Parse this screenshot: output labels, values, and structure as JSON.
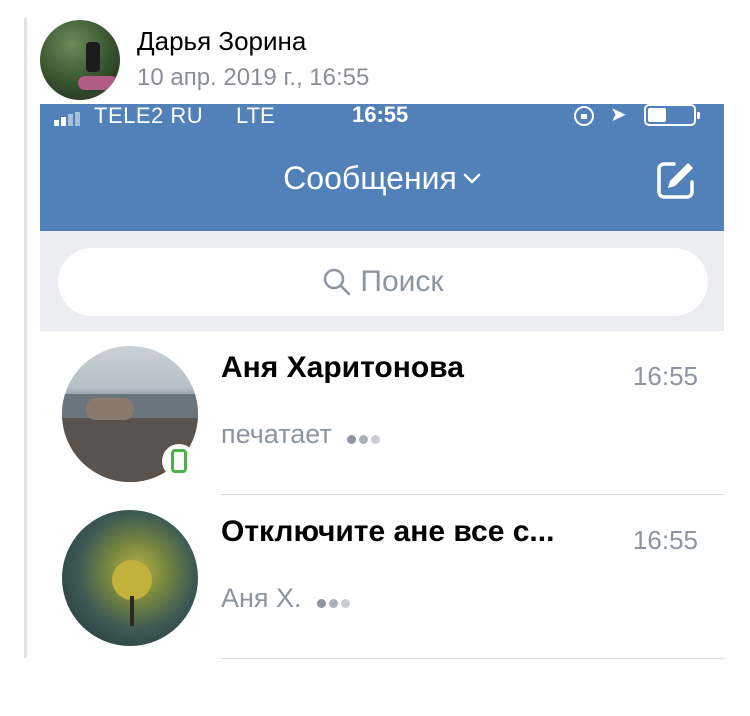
{
  "post": {
    "author": "Дарья Зорина",
    "date": "10 апр. 2019 г., 16:55"
  },
  "status_bar": {
    "carrier": "TELE2 RU",
    "network": "LTE",
    "time": "16:55",
    "icons": [
      "signal-icon",
      "lock-rotation-icon",
      "location-icon",
      "battery-icon"
    ]
  },
  "header": {
    "title": "Сообщения",
    "title_icon": "chevron-down-icon",
    "compose_icon": "compose-icon",
    "color": "#5181b8"
  },
  "search": {
    "placeholder": "Поиск"
  },
  "dialogs": [
    {
      "name": "Аня Харитонова",
      "time": "16:55",
      "preview": "печатает",
      "typing": true,
      "online_mobile": true
    },
    {
      "name": "Отключите ане все с...",
      "time": "16:55",
      "preview": "Аня Х.",
      "typing": true,
      "online_mobile": false
    }
  ],
  "colors": {
    "accent": "#5181b8",
    "online": "#4bb34b",
    "secondary_text": "#8c95a0"
  }
}
